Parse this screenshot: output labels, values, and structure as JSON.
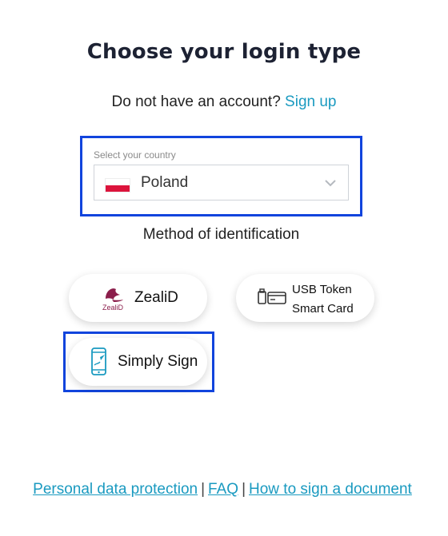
{
  "header": {
    "title": "Choose your login type",
    "no_account_text": "Do not have an account?",
    "signup_link": "Sign up"
  },
  "country": {
    "label": "Select your country",
    "selected": "Poland"
  },
  "method": {
    "label": "Method of identification",
    "options": [
      {
        "label": "ZealiD",
        "logo_text": "ZealiD"
      },
      {
        "label_line1": "USB Token",
        "label_line2": "Smart Card"
      },
      {
        "label": "Simply Sign"
      }
    ]
  },
  "footer": {
    "links": [
      "Personal data protection",
      "FAQ",
      "How to sign a document"
    ],
    "separator": "|"
  },
  "colors": {
    "accent": "#1a9ac0",
    "highlight": "#1144dd",
    "zealid_brand": "#8b1e4b"
  }
}
